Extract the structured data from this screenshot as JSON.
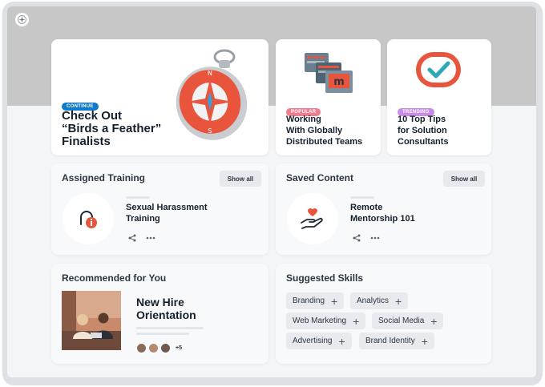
{
  "hero": {
    "badge": "CONTINUE",
    "title_line1": "Check Out",
    "title_line2": "“Birds a Feather”",
    "title_line3": "Finalists"
  },
  "card_popular": {
    "badge": "POPULAR",
    "title_line1": "Working",
    "title_line2": "With Globally",
    "title_line3": "Distributed Teams"
  },
  "card_trending": {
    "badge": "TRENDING",
    "title_line1": "10 Top Tips",
    "title_line2": "for Solution",
    "title_line3": "Consultants"
  },
  "assigned_training": {
    "heading": "Assigned Training",
    "show_all": "Show all",
    "item_line1": "Sexual Harassment",
    "item_line2": "Training"
  },
  "saved_content": {
    "heading": "Saved Content",
    "show_all": "Show all",
    "item_line1": "Remote",
    "item_line2": "Mentorship 101"
  },
  "recommended": {
    "heading": "Recommended for You",
    "title_line1": "New Hire",
    "title_line2": "Orientation",
    "extra_count": "+5"
  },
  "suggested_skills": {
    "heading": "Suggested Skills",
    "skills": [
      "Branding",
      "Analytics",
      "Web Marketing",
      "Social Media",
      "Advertising",
      "Brand Identity"
    ]
  },
  "colors": {
    "accent_blue": "#0f7ac9",
    "accent_red": "#e8553c",
    "badge_pink": "#f27c8e",
    "badge_purple": "#c98be8"
  }
}
